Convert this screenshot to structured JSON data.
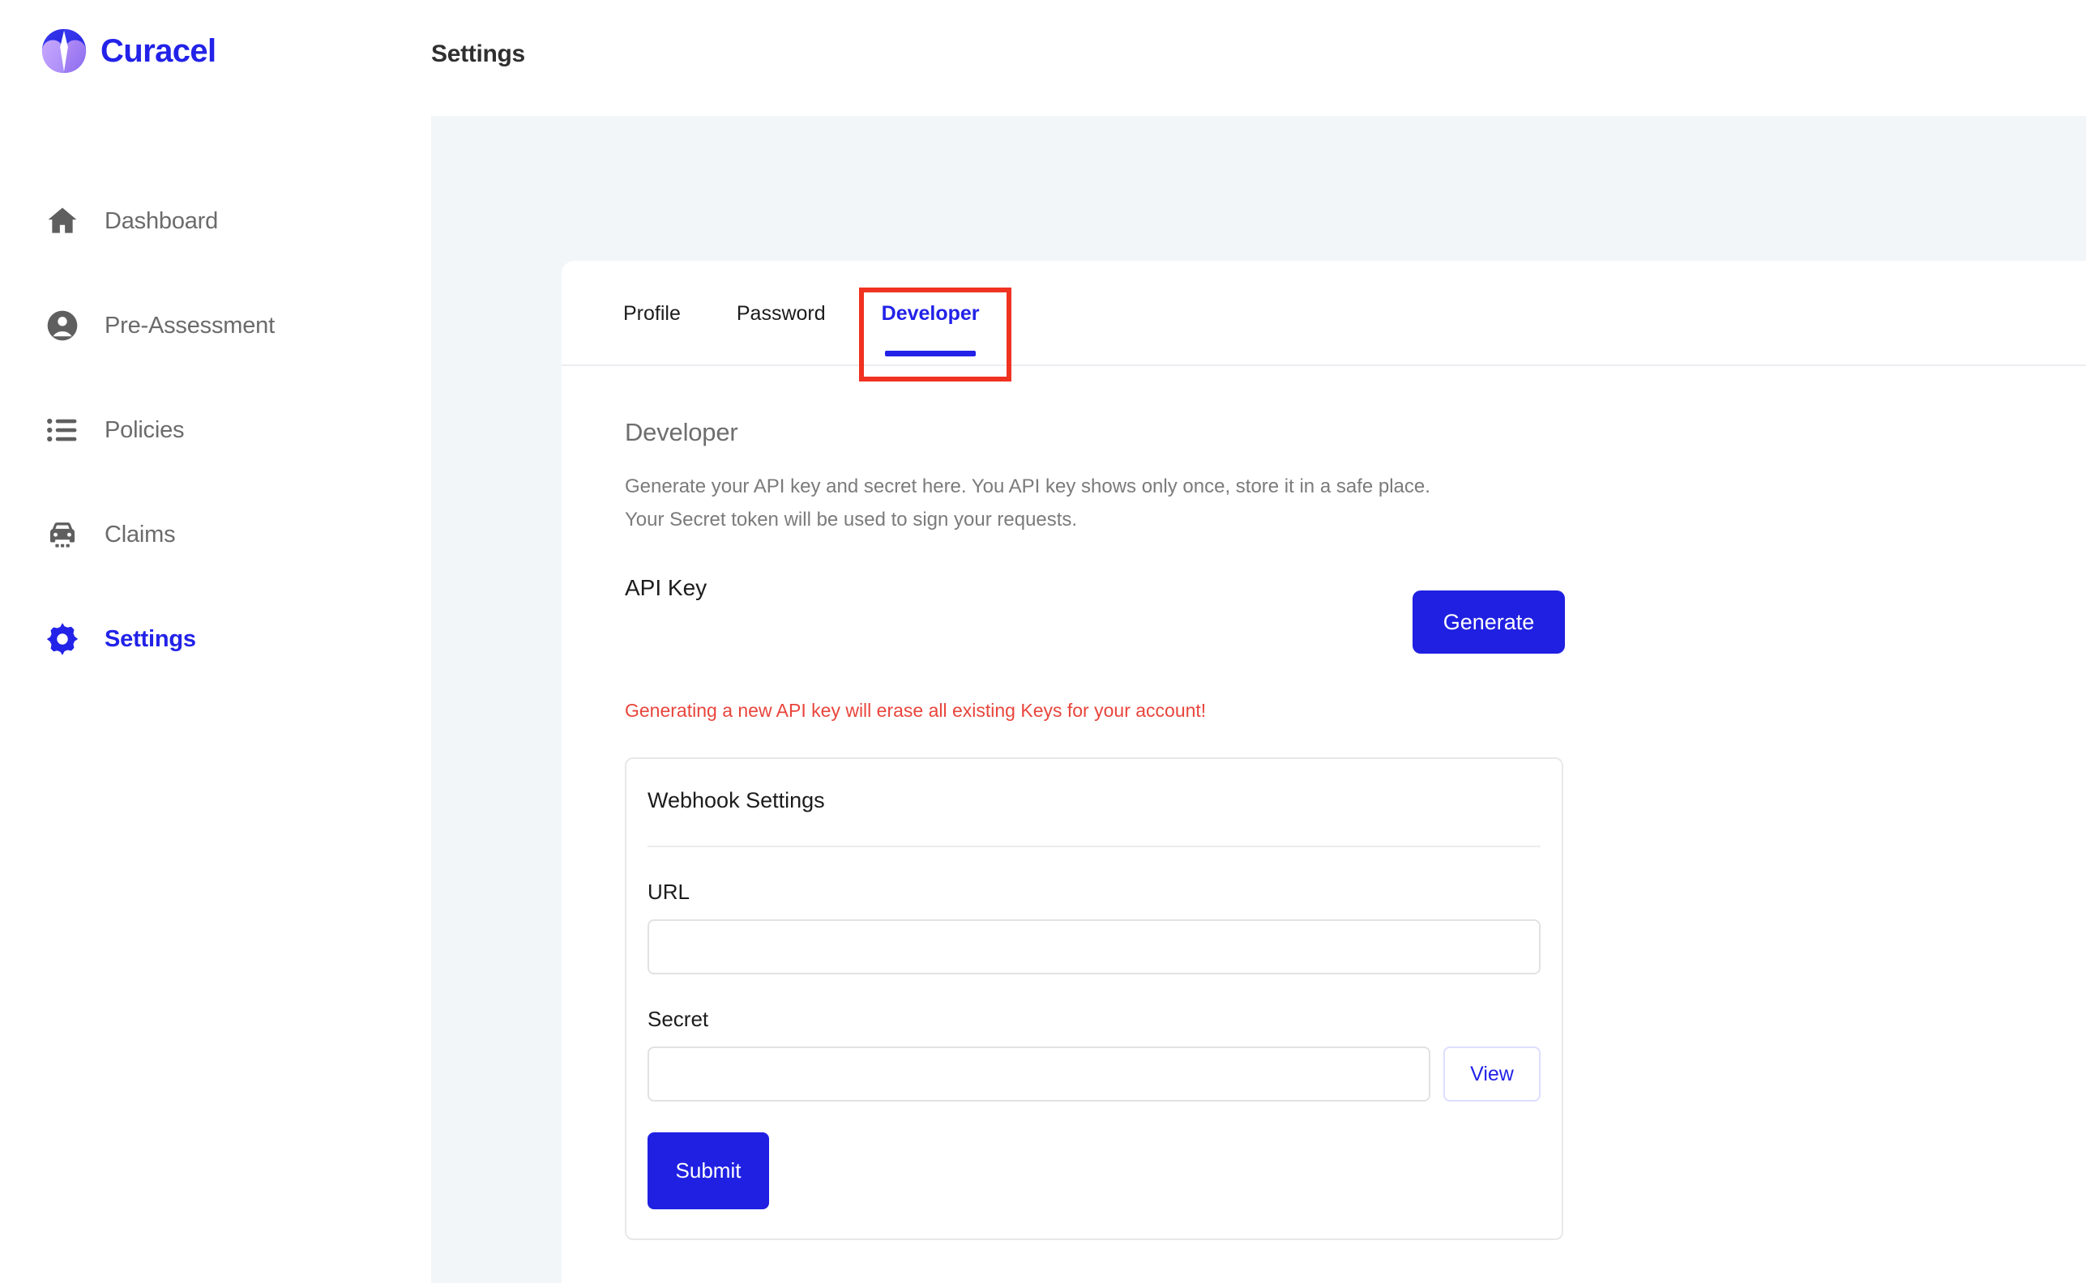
{
  "brand": {
    "name": "Curacel",
    "logo_icon": "curacel-diamond-logo",
    "accent": "#2222e8"
  },
  "header": {
    "title": "Settings"
  },
  "sidebar": {
    "items": [
      {
        "label": "Dashboard",
        "icon": "home-icon",
        "active": false
      },
      {
        "label": "Pre-Assessment",
        "icon": "person-icon",
        "active": false
      },
      {
        "label": "Policies",
        "icon": "list-icon",
        "active": false
      },
      {
        "label": "Claims",
        "icon": "car-icon",
        "active": false
      },
      {
        "label": "Settings",
        "icon": "gear-icon",
        "active": true
      }
    ]
  },
  "tabs": [
    {
      "label": "Profile",
      "active": false
    },
    {
      "label": "Password",
      "active": false
    },
    {
      "label": "Developer",
      "active": true
    }
  ],
  "highlight": {
    "color": "#f03221",
    "target": "Developer"
  },
  "developer": {
    "title": "Developer",
    "description_line1": "Generate your API key and secret here. You API key shows only once, store it in a safe place.",
    "description_line2": "Your Secret token will be used to sign your requests.",
    "api_key_label": "API Key",
    "generate_label": "Generate",
    "warning": "Generating a new API key will erase all existing Keys for your account!",
    "warning_color": "#e8453c"
  },
  "webhook": {
    "heading": "Webhook Settings",
    "url_label": "URL",
    "url_value": "",
    "url_placeholder": "",
    "secret_label": "Secret",
    "secret_value": "",
    "secret_placeholder": "",
    "view_label": "View",
    "submit_label": "Submit"
  }
}
